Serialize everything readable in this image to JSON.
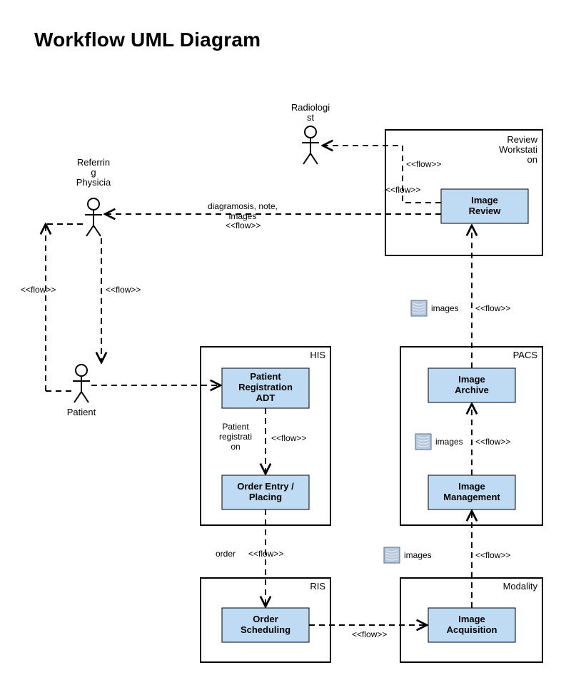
{
  "title": "Workflow UML Diagram",
  "actors": {
    "radiologist": "Radiologi\nst",
    "physician": "Referrin\ng\nPhysicia",
    "patient": "Patient"
  },
  "containers": {
    "reviewWorkstation": "Review\nWorkstati\non",
    "his": "HIS",
    "pacs": "PACS",
    "ris": "RIS",
    "modality": "Modality"
  },
  "nodes": {
    "imageReview": "Image\nReview",
    "patientRegistration": "Patient\nRegistration\nADT",
    "orderEntry": "Order Entry /\nPlacing",
    "orderScheduling": "Order\nScheduling",
    "imageAcquisition": "Image\nAcquisition",
    "imageManagement": "Image\nManagement",
    "imageArchive": "Image\nArchive"
  },
  "flows": {
    "flowLabel": "<<flow>>",
    "diagnosis": "diagramosis, note,\nimages",
    "patientRegistration": "Patient\nregistrati\non",
    "order": "order",
    "images": "images"
  }
}
